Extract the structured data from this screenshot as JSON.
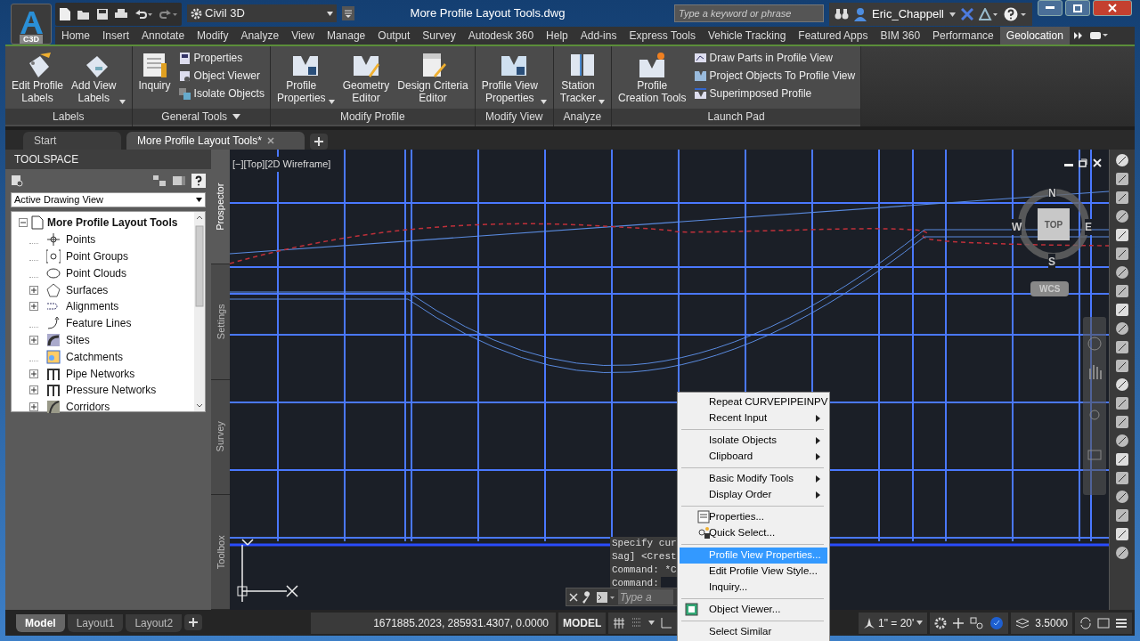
{
  "title_bar": {
    "app_badge": "C3D",
    "workspace": "Civil 3D",
    "title": "More Profile Layout Tools.dwg",
    "search": {
      "placeholder": "Type a keyword or phrase"
    },
    "user": "Eric_Chappell"
  },
  "ribbon_tabs": [
    {
      "label": "Home",
      "selected": false
    },
    {
      "label": "Insert",
      "selected": false
    },
    {
      "label": "Annotate",
      "selected": false
    },
    {
      "label": "Modify",
      "selected": false
    },
    {
      "label": "Analyze",
      "selected": false
    },
    {
      "label": "View",
      "selected": false
    },
    {
      "label": "Manage",
      "selected": false
    },
    {
      "label": "Output",
      "selected": false
    },
    {
      "label": "Survey",
      "selected": false
    },
    {
      "label": "Autodesk 360",
      "selected": false
    },
    {
      "label": "Help",
      "selected": false
    },
    {
      "label": "Add-ins",
      "selected": false
    },
    {
      "label": "Express Tools",
      "selected": false
    },
    {
      "label": "Vehicle Tracking",
      "selected": false
    },
    {
      "label": "Featured Apps",
      "selected": false
    },
    {
      "label": "BIM 360",
      "selected": false
    },
    {
      "label": "Performance",
      "selected": false
    },
    {
      "label": "Geolocation",
      "selected": true
    }
  ],
  "ribbon_panels": [
    {
      "title": "Labels",
      "menu": false,
      "buttons": [
        {
          "kind": "large",
          "lines": [
            "Edit Profile",
            "Labels"
          ],
          "dropdown": false
        },
        {
          "kind": "large",
          "lines": [
            "Add View",
            "Labels"
          ],
          "dropdown": true
        }
      ]
    },
    {
      "title": "General Tools",
      "menu": true,
      "buttons": [
        {
          "kind": "large",
          "lines": [
            "Inquiry"
          ],
          "dropdown": false
        },
        {
          "kind": "stack",
          "items": [
            "Properties",
            "Object Viewer",
            "Isolate Objects"
          ]
        }
      ]
    },
    {
      "title": "Modify Profile",
      "menu": false,
      "buttons": [
        {
          "kind": "large",
          "lines": [
            "Profile",
            "Properties"
          ],
          "dropdown": true
        },
        {
          "kind": "large",
          "lines": [
            "Geometry",
            "Editor"
          ],
          "dropdown": false
        },
        {
          "kind": "large",
          "lines": [
            "Design Criteria",
            "Editor"
          ],
          "dropdown": false
        }
      ]
    },
    {
      "title": "Modify View",
      "menu": false,
      "buttons": [
        {
          "kind": "large",
          "lines": [
            "Profile View",
            "Properties"
          ],
          "dropdown": true
        }
      ]
    },
    {
      "title": "Analyze",
      "menu": false,
      "buttons": [
        {
          "kind": "large",
          "lines": [
            "Station",
            "Tracker"
          ],
          "dropdown": true
        }
      ]
    },
    {
      "title": "Launch Pad",
      "menu": false,
      "buttons": [
        {
          "kind": "large",
          "lines": [
            "Profile",
            "Creation Tools"
          ],
          "dropdown": false
        },
        {
          "kind": "stack",
          "items": [
            "Draw Parts in Profile View",
            "Project Objects To Profile View",
            "Superimposed Profile"
          ]
        }
      ]
    }
  ],
  "document_tabs": [
    {
      "label": "Start",
      "selected": false
    },
    {
      "label": "More Profile Layout Tools*",
      "selected": true
    }
  ],
  "toolspace": {
    "title": "TOOLSPACE",
    "view": "Active Drawing View",
    "tree": [
      {
        "label": "More Profile Layout Tools",
        "expanded": true,
        "children": [
          {
            "label": "Points",
            "expandable": false
          },
          {
            "label": "Point Groups",
            "expandable": false
          },
          {
            "label": "Point Clouds",
            "expandable": false
          },
          {
            "label": "Surfaces",
            "expandable": true
          },
          {
            "label": "Alignments",
            "expandable": true
          },
          {
            "label": "Feature Lines",
            "expandable": false
          },
          {
            "label": "Sites",
            "expandable": true
          },
          {
            "label": "Catchments",
            "expandable": false
          },
          {
            "label": "Pipe Networks",
            "expandable": true
          },
          {
            "label": "Pressure Networks",
            "expandable": true
          },
          {
            "label": "Corridors",
            "expandable": true
          }
        ]
      }
    ],
    "side_tabs": [
      {
        "label": "Prospector",
        "selected": true
      },
      {
        "label": "Settings",
        "selected": false
      },
      {
        "label": "Survey",
        "selected": false
      },
      {
        "label": "Toolbox",
        "selected": false
      }
    ]
  },
  "viewport": {
    "label": "[−][Top][2D Wireframe]",
    "viewcube": {
      "north": "N",
      "south": "S",
      "west": "W",
      "east": "E",
      "face": "TOP",
      "ucs": "WCS"
    },
    "command_history": [
      "Specify cur",
      "Sag] <Crest",
      "Command: *C",
      "Command:"
    ],
    "command_input": {
      "placeholder": "Type a"
    }
  },
  "context_menu": [
    [
      {
        "label": "Repeat CURVEPIPEINPV",
        "submenu": false,
        "has_icon": false,
        "selected": false
      },
      {
        "label": "Recent Input",
        "submenu": true,
        "has_icon": false,
        "selected": false
      }
    ],
    [
      {
        "label": "Isolate Objects",
        "submenu": true,
        "has_icon": false,
        "selected": false
      },
      {
        "label": "Clipboard",
        "submenu": true,
        "has_icon": false,
        "selected": false
      }
    ],
    [
      {
        "label": "Basic Modify Tools",
        "submenu": true,
        "has_icon": false,
        "selected": false
      },
      {
        "label": "Display Order",
        "submenu": true,
        "has_icon": false,
        "selected": false
      }
    ],
    [
      {
        "label": "Properties...",
        "submenu": false,
        "has_icon": true,
        "selected": false
      },
      {
        "label": "Quick Select...",
        "submenu": false,
        "has_icon": true,
        "selected": false
      }
    ],
    [
      {
        "label": "Profile View Properties...",
        "submenu": false,
        "has_icon": false,
        "selected": true
      },
      {
        "label": "Edit Profile View Style...",
        "submenu": false,
        "has_icon": false,
        "selected": false
      },
      {
        "label": "Inquiry...",
        "submenu": false,
        "has_icon": false,
        "selected": false
      }
    ],
    [
      {
        "label": "Object Viewer...",
        "submenu": false,
        "has_icon": true,
        "selected": false
      }
    ],
    [
      {
        "label": "Select Similar",
        "submenu": false,
        "has_icon": false,
        "selected": false
      }
    ]
  ],
  "layout_tabs": [
    {
      "label": "Model",
      "selected": true
    },
    {
      "label": "Layout1",
      "selected": false
    },
    {
      "label": "Layout2",
      "selected": false
    }
  ],
  "status_bar": {
    "coordinates": "1671885.2023, 285931.4307, 0.0000",
    "space": "MODEL",
    "scale": "1\" = 20'",
    "value": "3.5000"
  }
}
